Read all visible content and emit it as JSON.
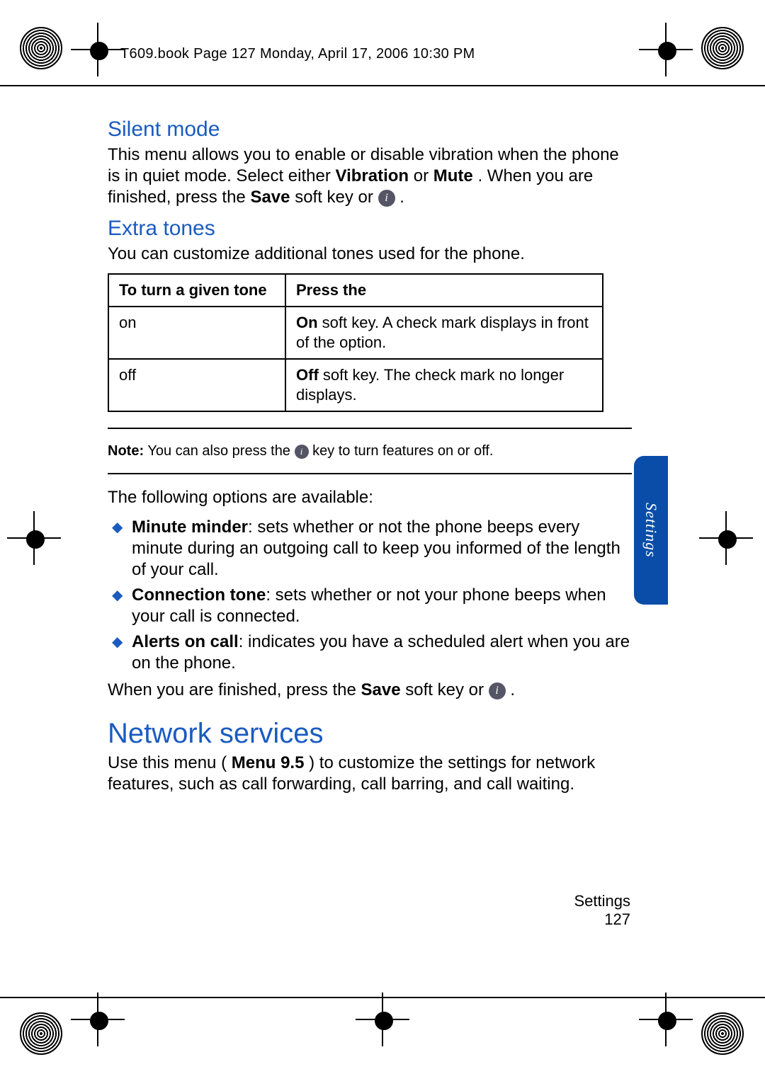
{
  "running_header": "T609.book  Page 127  Monday, April 17, 2006  10:30 PM",
  "silent": {
    "heading": "Silent mode",
    "body_a": "This menu allows you to enable or disable vibration when the phone is in quiet mode. Select either ",
    "vibration": "Vibration",
    "or": " or ",
    "mute": "Mute",
    "body_b": ". When you are finished, press the ",
    "save": "Save",
    "body_c": " soft key or ",
    "period": "."
  },
  "extra": {
    "heading": "Extra tones",
    "intro": "You can customize additional tones used for the phone.",
    "table": {
      "h1": "To turn a given tone",
      "h2": "Press the",
      "r1c1": "on",
      "r1_on": "On",
      "r1_rest": " soft key. A check mark displays in front of the option.",
      "r2c1": "off",
      "r2_off": "Off",
      "r2_rest": " soft key. The check mark no longer displays."
    },
    "note_label": "Note:",
    "note_a": " You can also press the ",
    "note_b": " key to turn features on or off.",
    "options_intro": "The following options are available:",
    "items": {
      "mm_b": "Minute minder",
      "mm_r": ": sets whether or not the phone beeps every minute during an outgoing call to keep you informed of the length of your call.",
      "ct_b": "Connection tone",
      "ct_r": ": sets whether or not your phone beeps when your call is connected.",
      "ao_b": "Alerts on call",
      "ao_r": ": indicates you have a scheduled alert when you are on the phone."
    },
    "finish_a": "When you are finished, press the ",
    "finish_save": "Save",
    "finish_b": " soft key or ",
    "finish_period": "."
  },
  "network": {
    "heading": "Network services",
    "body_a": "Use this menu (",
    "menu": "Menu 9.5",
    "body_b": ") to customize the settings for network features, such as call forwarding, call barring, and call waiting."
  },
  "side_tab": "Settings",
  "footer_section": "Settings",
  "footer_page": "127",
  "key_glyph": "i"
}
